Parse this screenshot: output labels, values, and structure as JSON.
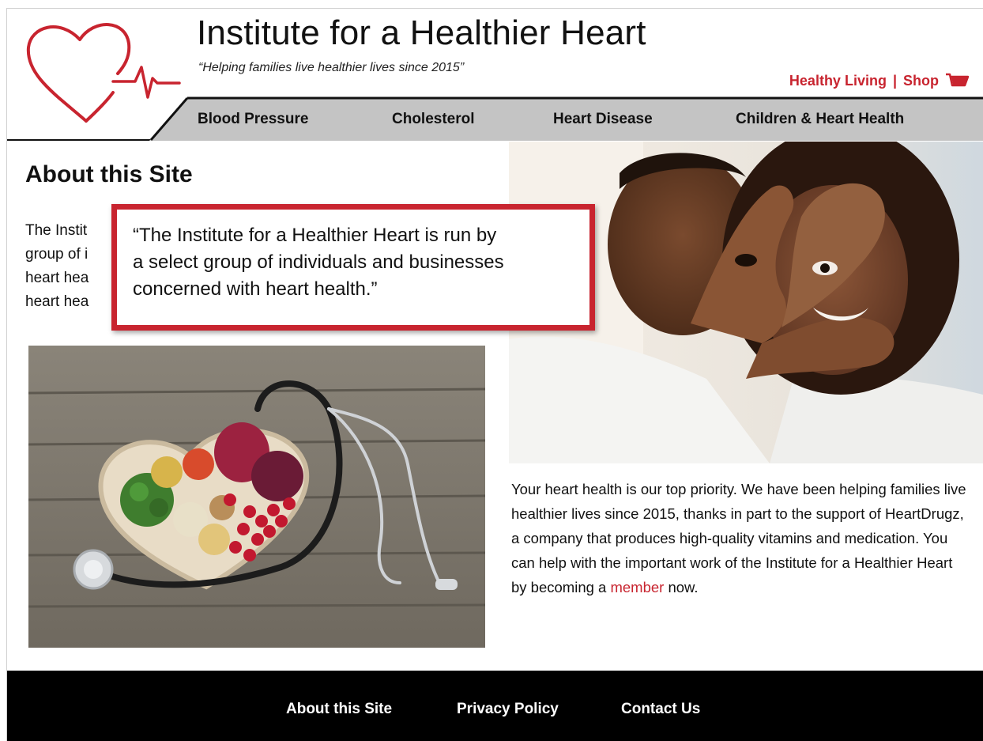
{
  "header": {
    "site_title": "Institute for a Healthier Heart",
    "tagline": "“Helping families live healthier lives since 2015”",
    "links": {
      "healthy_living": "Healthy Living",
      "separator": "|",
      "shop": "Shop"
    }
  },
  "nav": {
    "items": [
      {
        "label": "Blood Pressure"
      },
      {
        "label": "Cholesterol"
      },
      {
        "label": "Heart Disease"
      },
      {
        "label": "Children & Heart Health"
      }
    ]
  },
  "main": {
    "heading": "About this Site",
    "intro_lines": [
      "The Instit",
      "group of i",
      "heart hea",
      "heart hea"
    ],
    "callout_lines": [
      "“The Institute for a Healthier Heart is run by",
      " a select group of individuals and businesses",
      "concerned with heart health.”"
    ],
    "body_before_link": "Your heart health is our top priority. We have been helping families live healthier lives since 2015, thanks in part to the support of HeartDrugz, a company that produces high-quality vitamins and medication. You can help with the important work of the Institute for a Healthier Heart by becoming a ",
    "body_link": "member",
    "body_after_link": " now."
  },
  "footer": {
    "links": [
      "About this Site",
      "Privacy Policy",
      "Contact Us"
    ]
  },
  "colors": {
    "accent_red": "#c8242f",
    "nav_gray": "#c4c4c4",
    "footer_black": "#000000"
  },
  "icons": {
    "logo": "heart-heartbeat-logo",
    "cart": "shopping-cart-icon"
  }
}
